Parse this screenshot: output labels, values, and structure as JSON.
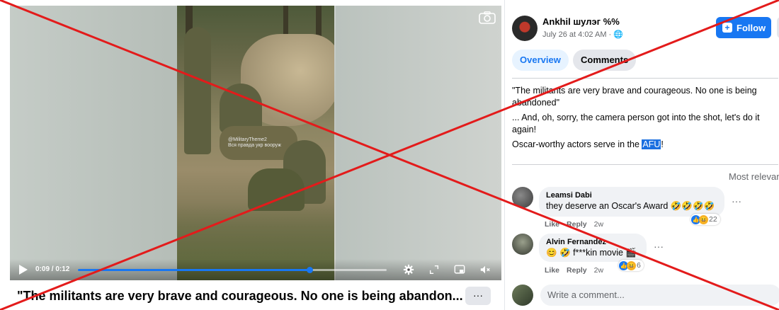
{
  "video": {
    "watermark_line1": "@MilitaryTheme2",
    "watermark_line2": "Вся правда укр вооруж",
    "time_display": "0:09 / 0:12",
    "progress_fraction": 0.75,
    "caption": "\"The militants are very brave and courageous. No one is being abandon...",
    "more_label": "···"
  },
  "post": {
    "author": "Ankhil шулэг %%",
    "date": "July 26 at 4:02 AM · ",
    "follow_label": "Follow",
    "tabs": [
      {
        "label": "Overview",
        "active": true
      },
      {
        "label": "Comments",
        "active": false
      }
    ],
    "text_lines": [
      "\"The militants are very brave and courageous. No one is being abandoned\"",
      "... And, oh, sorry, the camera person got into the shot, let's do it again!"
    ],
    "text_line3_prefix": "Oscar-worthy actors serve in the ",
    "text_line3_highlight": "AFU",
    "text_line3_suffix": "!"
  },
  "comments": {
    "sort_label": "Most relevant",
    "items": [
      {
        "name": "Leamsi Dabi",
        "text": "they deserve an Oscar's Award 🤣🤣🤣🤣",
        "like": "Like",
        "reply": "Reply",
        "age": "2w",
        "reactions": "22"
      },
      {
        "name": "Alvin Fernandez",
        "text": "😊 🤣 f***kin movie 🎬",
        "like": "Like",
        "reply": "Reply",
        "age": "2w",
        "reactions": "6"
      }
    ],
    "write_placeholder": "Write a comment..."
  },
  "colors": {
    "accent": "#1877f2",
    "cross": "#e31b1b"
  }
}
